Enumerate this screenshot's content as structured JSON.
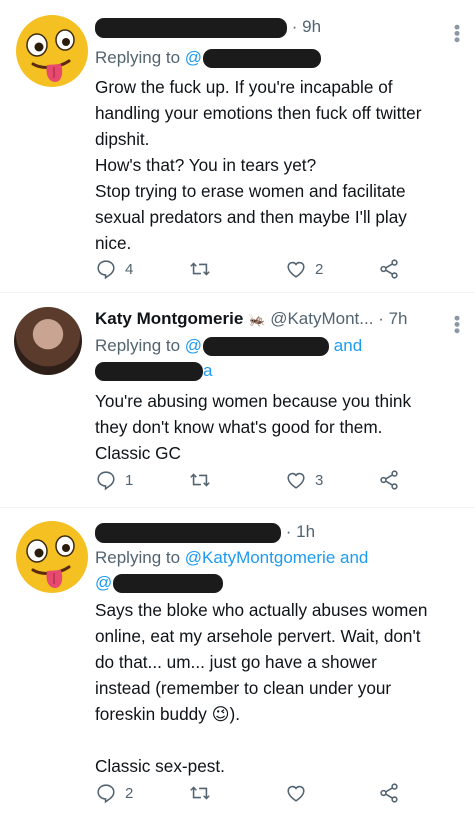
{
  "tweets": [
    {
      "time": "· 9h",
      "replying_prefix": "Replying to",
      "replying_handle_prefix": "@",
      "text": "Grow the fuck up. If you're incapable of\nhandling your emotions then fuck off twitter\ndipshit.\nHow's that? You in tears yet?\nStop trying to erase women and facilitate\nsexual predators and then maybe I'll play\nnice.",
      "reply_count": "4",
      "retweet_count": "",
      "like_count": "2"
    },
    {
      "name": "Katy Montgomerie",
      "badge_icon": "cricket-icon",
      "handle": "@KatyMont...",
      "time": "· 7h",
      "replying_prefix": "Replying to",
      "replying_handle_prefix": "@",
      "replying_and": "and",
      "replying_tail": "a",
      "text": "You're abusing women because you think\nthey don't know what's good for them.\nClassic GC",
      "reply_count": "1",
      "retweet_count": "",
      "like_count": "3"
    },
    {
      "time": "· 1h",
      "replying_prefix": "Replying to",
      "replying_handle": "@KatyMontgomerie and",
      "replying_handle2_prefix": "@",
      "text_before_emoji": "Says the bloke who actually abuses women\nonline, eat my arsehole pervert. Wait, don't\ndo that... um... just go have a shower\ninstead (remember to clean under your\nforeskin buddy ",
      "emoji": "😉",
      "text_after_emoji": ").\n\nClassic sex-pest.",
      "reply_count": "2",
      "retweet_count": "",
      "like_count": ""
    }
  ],
  "colors": {
    "link": "#1d9bf0",
    "muted": "#536471",
    "redaction": "#1b1b1b"
  }
}
